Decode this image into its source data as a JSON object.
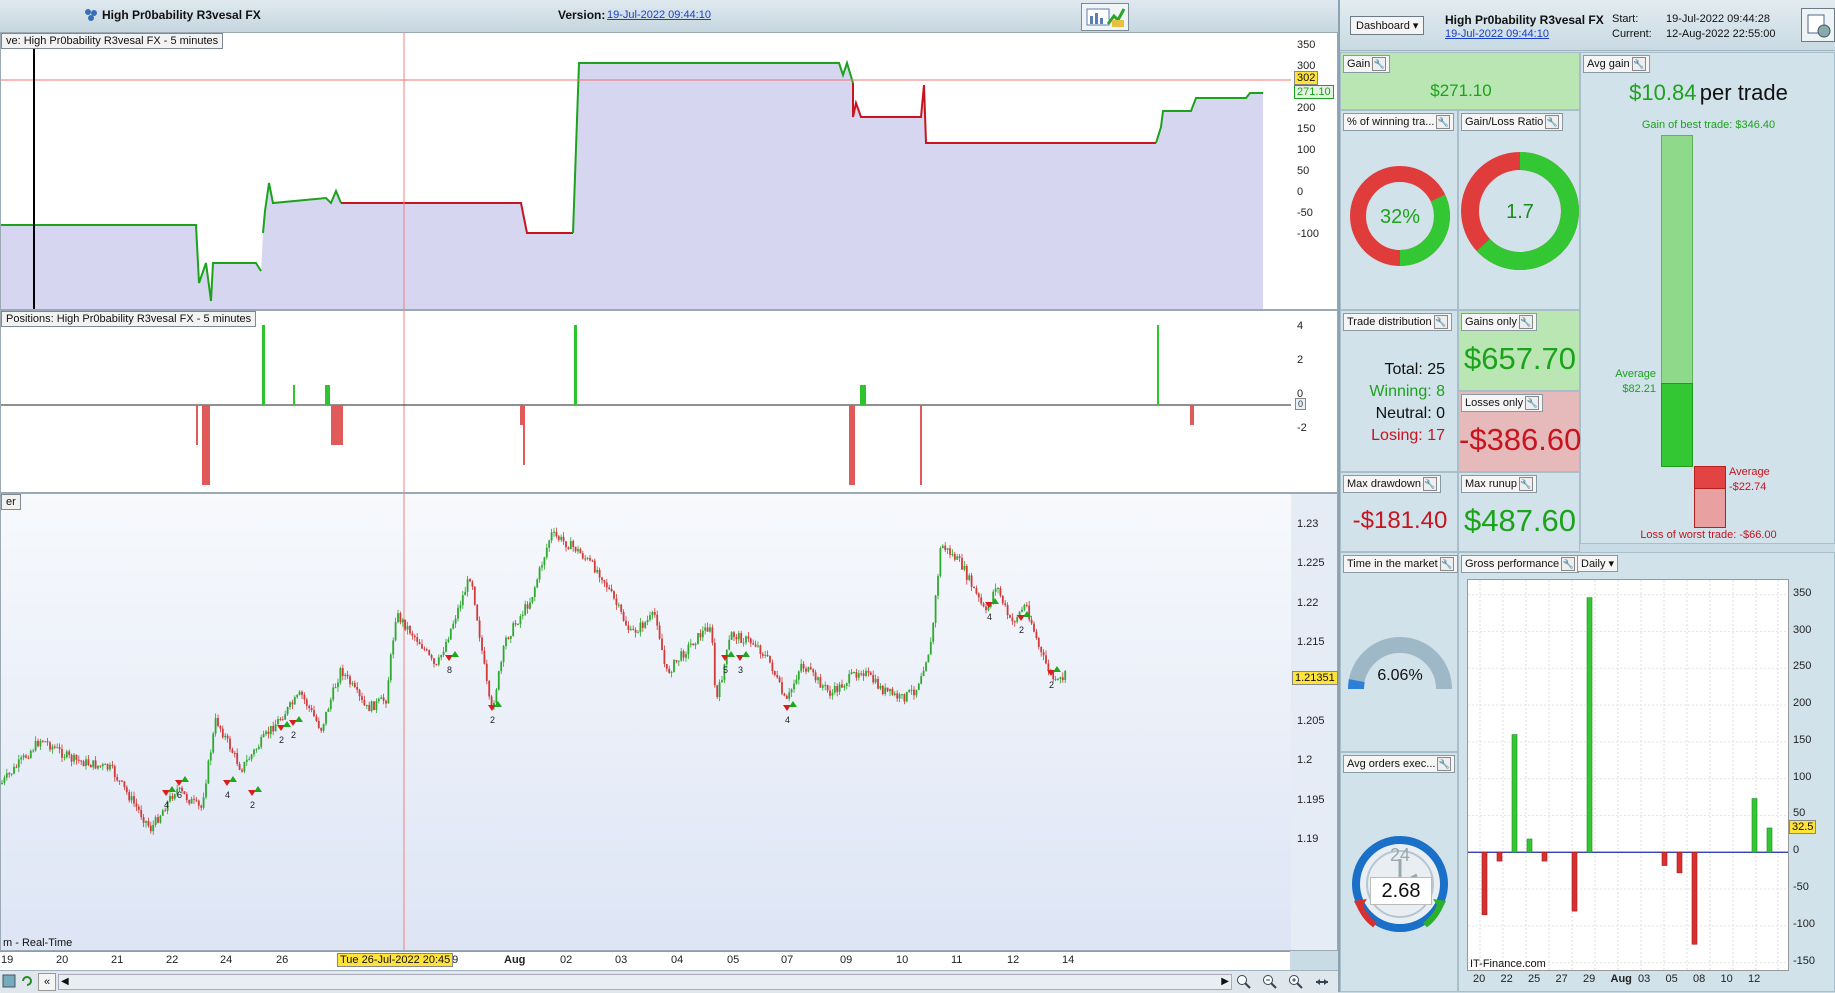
{
  "header": {
    "title": "High Pr0bability R3vesal FX",
    "version_label": "Version:",
    "version_value": "19-Jul-2022 09:44:10"
  },
  "equity_panel": {
    "label": "ve: High Pr0bability R3vesal FX - 5 minutes",
    "y_ticks": [
      "350",
      "300",
      "250",
      "200",
      "150",
      "100",
      "50",
      "0",
      "-50",
      "-100"
    ],
    "tag_value": "302",
    "tag_current": "271.10"
  },
  "positions_panel": {
    "label": "Positions: High Pr0bability R3vesal FX - 5 minutes",
    "y_ticks": [
      "4",
      "2",
      "0",
      "-2"
    ]
  },
  "price_panel": {
    "label": "er",
    "realtime_label": "m - Real-Time",
    "y_ticks": [
      "1.23",
      "1.225",
      "1.22",
      "1.215",
      "1.21",
      "1.205",
      "1.2",
      "1.195",
      "1.19"
    ],
    "current_price": "1.21351",
    "trade_markers": [
      "4",
      "6",
      "4",
      "2",
      "2",
      "2",
      "8",
      "2",
      "5",
      "3",
      "4",
      "4",
      "2",
      "2"
    ]
  },
  "x_axis": {
    "labels": [
      "19",
      "20",
      "21",
      "22",
      "24",
      "26",
      "28",
      "29",
      "Aug",
      "02",
      "03",
      "04",
      "05",
      "07",
      "09",
      "10",
      "11",
      "12",
      "14"
    ],
    "cursor_label": "Tue 26-Jul-2022 20:45"
  },
  "dashboard": {
    "dropdown": "Dashboard",
    "title": "High Pr0bability R3vesal FX",
    "version_link": "19-Jul-2022 09:44:10",
    "start_label": "Start:",
    "start_value": "19-Jul-2022 09:44:28",
    "current_label": "Current:",
    "current_value": "12-Aug-2022 22:55:00",
    "gain": {
      "title": "Gain",
      "value": "$271.10"
    },
    "avg_gain": {
      "title": "Avg gain",
      "value": "$10.84",
      "suffix": "per trade",
      "best_label": "Gain of best trade: $346.40",
      "avg_pos_label": "Average",
      "avg_pos_value": "$82.21",
      "avg_neg_label": "Average",
      "avg_neg_value": "-$22.74",
      "worst_label": "Loss of worst trade: -$66.00"
    },
    "winning_pct": {
      "title": "% of winning tra...",
      "value": "32%",
      "fraction": 0.32
    },
    "gain_loss_ratio": {
      "title": "Gain/Loss Ratio",
      "value": "1.7",
      "fraction": 0.63
    },
    "trade_distribution": {
      "title": "Trade distribution",
      "total": "Total: 25",
      "winning": "Winning: 8",
      "neutral": "Neutral: 0",
      "losing": "Losing: 17"
    },
    "gains_only": {
      "title": "Gains only",
      "value": "$657.70"
    },
    "losses_only": {
      "title": "Losses only",
      "value": "-$386.60"
    },
    "max_drawdown": {
      "title": "Max drawdown",
      "value": "-$181.40"
    },
    "max_runup": {
      "title": "Max runup",
      "value": "$487.60"
    },
    "time_in_market": {
      "title": "Time in the market",
      "value": "6.06%",
      "fraction": 0.0606
    },
    "avg_orders": {
      "title": "Avg orders exec...",
      "value": "2.68",
      "clock_label": "24"
    },
    "gross_performance": {
      "title": "Gross performance",
      "period": "Daily",
      "watermark": "IT-Finance.com",
      "current_tag": "32.5"
    }
  },
  "chart_data": [
    {
      "type": "bar",
      "title": "Gross performance",
      "categories": [
        "20",
        "21",
        "22",
        "23",
        "25",
        "26",
        "27",
        "28",
        "29",
        "Aug",
        "02",
        "03",
        "04",
        "05",
        "06",
        "08",
        "09",
        "10",
        "11",
        "12"
      ],
      "values": [
        -85,
        -12,
        160,
        18,
        -12,
        0,
        -80,
        346,
        0,
        0,
        0,
        0,
        -18,
        -28,
        -125,
        0,
        0,
        0,
        73,
        33
      ],
      "x_tick_labels": [
        "20",
        "22",
        "25",
        "27",
        "29",
        "Aug",
        "03",
        "05",
        "08",
        "10",
        "12"
      ],
      "y_ticks": [
        350,
        300,
        250,
        200,
        150,
        100,
        50,
        0,
        -50,
        -100,
        -150
      ],
      "ylim": [
        -160,
        370
      ]
    }
  ],
  "colors": {
    "gain_green": "#1ba31b",
    "loss_red": "#c8141e",
    "equity_fill": "#d6d6f0"
  }
}
